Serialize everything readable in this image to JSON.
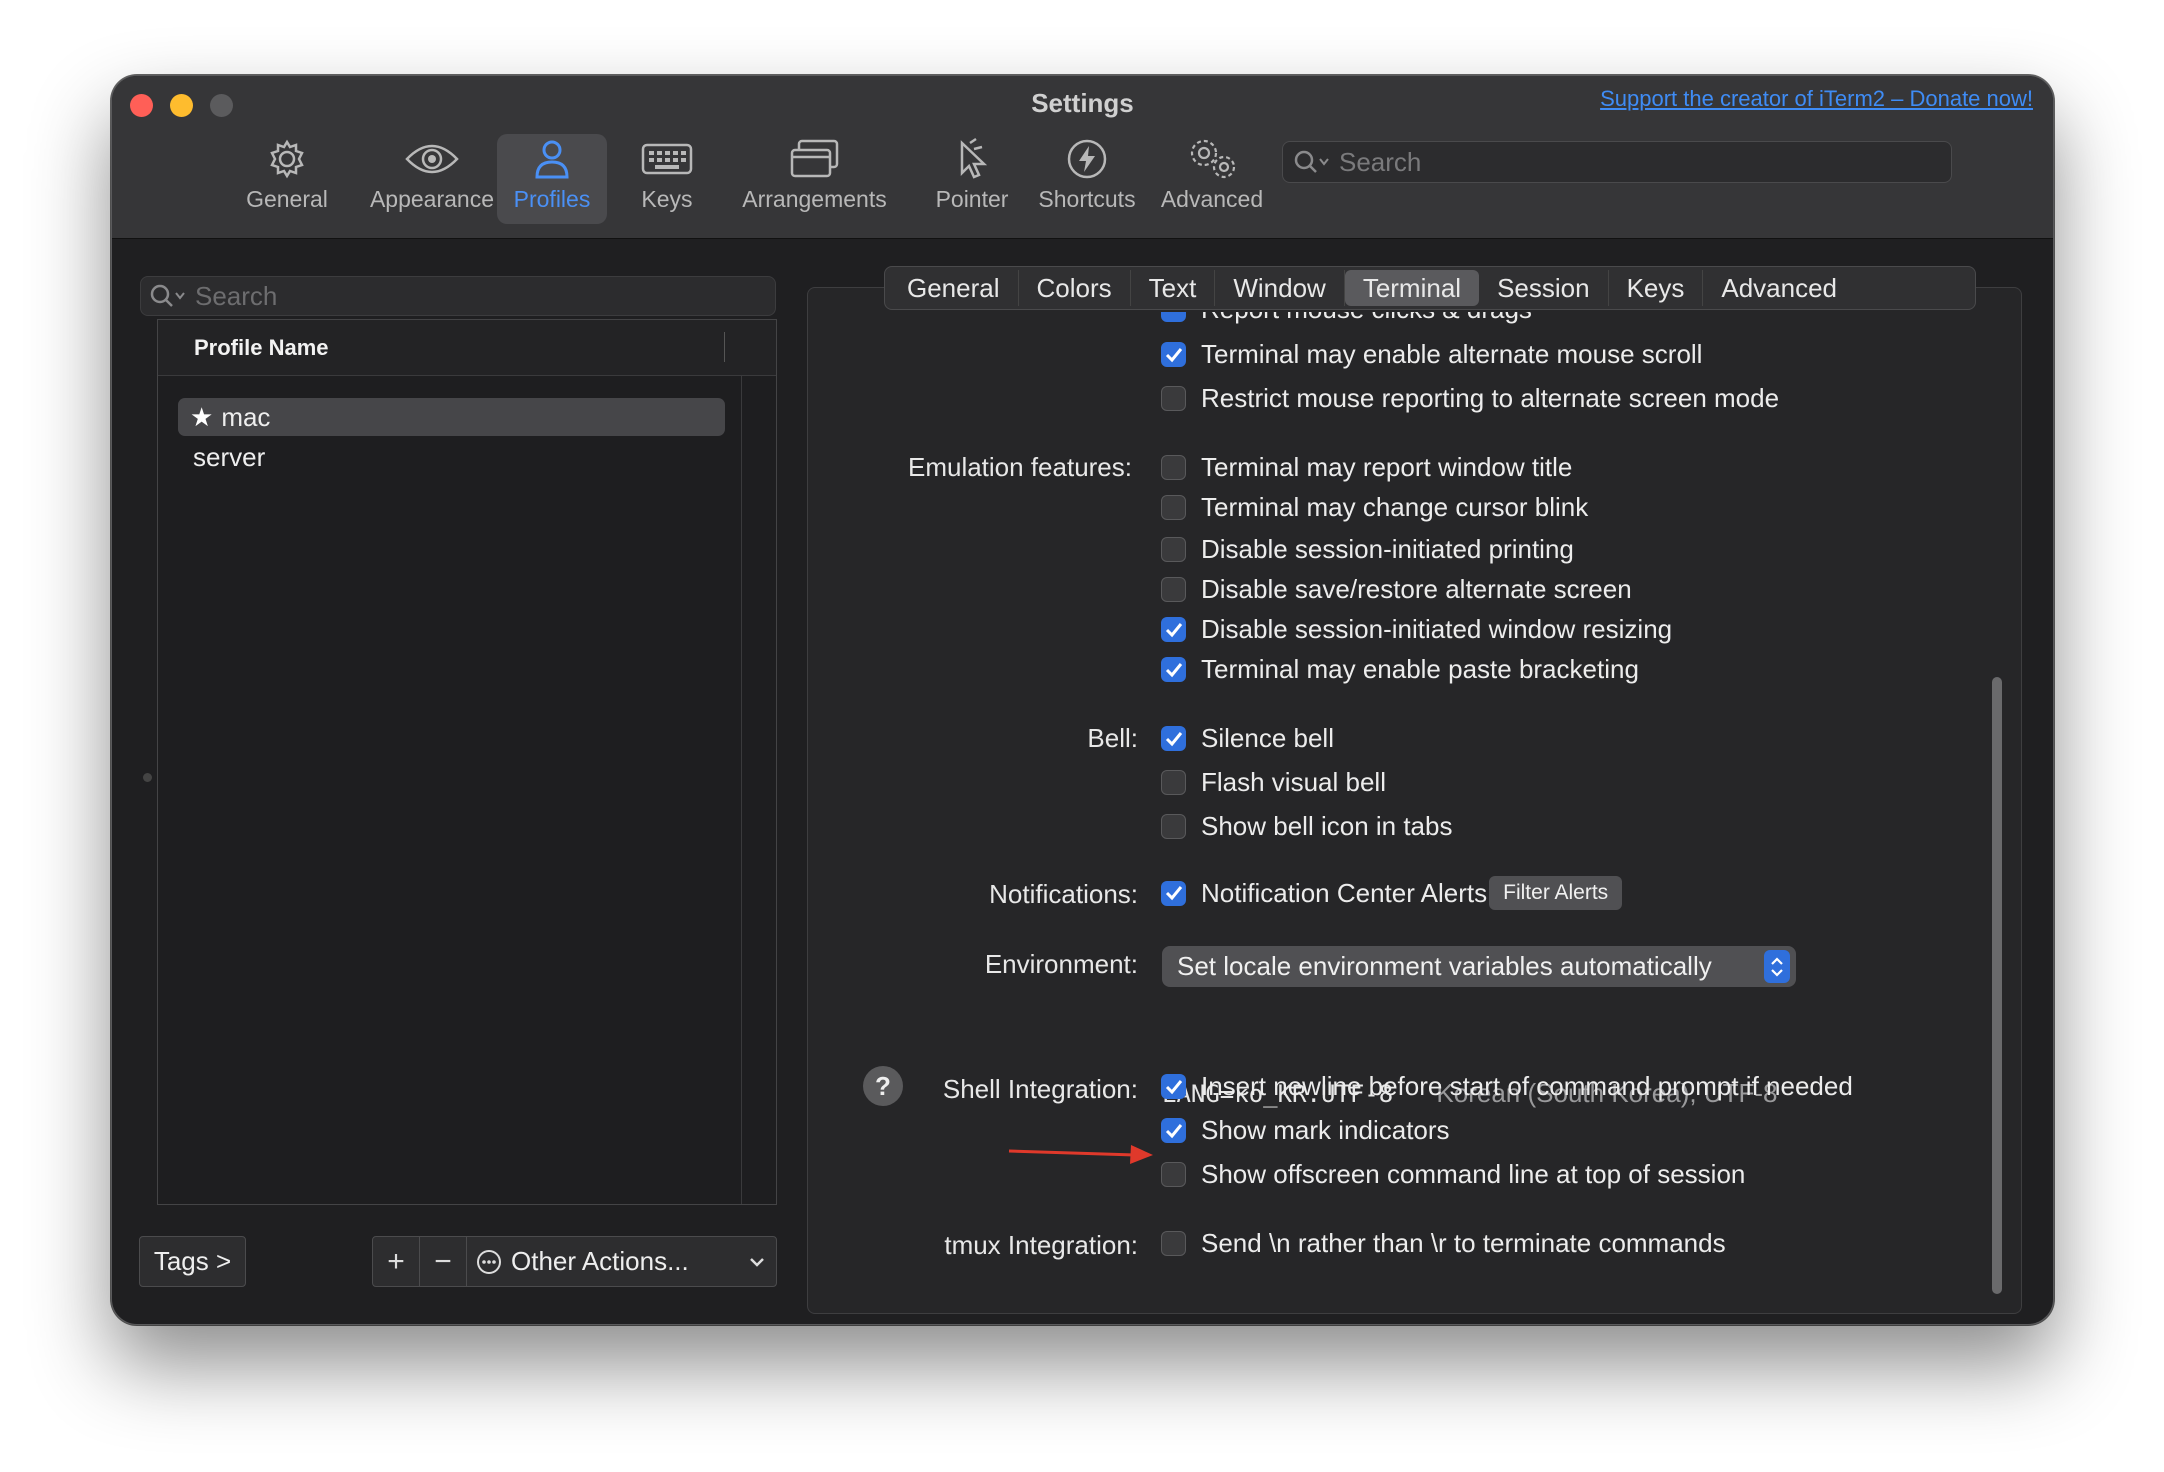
{
  "window": {
    "title": "Settings",
    "donate_link": "Support the creator of iTerm2 – Donate now!"
  },
  "toolbar": {
    "items": [
      {
        "label": "General",
        "icon": "gear-icon"
      },
      {
        "label": "Appearance",
        "icon": "eye-icon"
      },
      {
        "label": "Profiles",
        "icon": "person-icon",
        "active": true
      },
      {
        "label": "Keys",
        "icon": "keyboard-icon"
      },
      {
        "label": "Arrangements",
        "icon": "windows-icon"
      },
      {
        "label": "Pointer",
        "icon": "pointer-icon"
      },
      {
        "label": "Shortcuts",
        "icon": "bolt-icon"
      },
      {
        "label": "Advanced",
        "icon": "gears-icon"
      }
    ],
    "search_placeholder": "Search"
  },
  "profiles": {
    "search_placeholder": "Search",
    "column_header": "Profile Name",
    "items": [
      {
        "name": "mac",
        "default": true,
        "selected": true
      },
      {
        "name": "server",
        "default": false,
        "selected": false
      }
    ],
    "tags_button": "Tags >",
    "add_label": "+",
    "remove_label": "−",
    "other_actions": "Other Actions..."
  },
  "tabs": {
    "items": [
      "General",
      "Colors",
      "Text",
      "Window",
      "Terminal",
      "Session",
      "Keys",
      "Advanced"
    ],
    "active": "Terminal"
  },
  "terminal_settings": {
    "partial_top": "Report mouse clicks & drags",
    "mouse": [
      {
        "label": "Terminal may enable alternate mouse scroll",
        "checked": true
      },
      {
        "label": "Restrict mouse reporting to alternate screen mode",
        "checked": false
      }
    ],
    "emulation_label": "Emulation features:",
    "emulation": [
      {
        "label": "Terminal may report window title",
        "checked": false
      },
      {
        "label": "Terminal may change cursor blink",
        "checked": false
      },
      {
        "label": "Disable session-initiated printing",
        "checked": false
      },
      {
        "label": "Disable save/restore alternate screen",
        "checked": false
      },
      {
        "label": "Disable session-initiated window resizing",
        "checked": true
      },
      {
        "label": "Terminal may enable paste bracketing",
        "checked": true
      }
    ],
    "bell_label": "Bell:",
    "bell": [
      {
        "label": "Silence bell",
        "checked": true
      },
      {
        "label": "Flash visual bell",
        "checked": false
      },
      {
        "label": "Show bell icon in tabs",
        "checked": false
      }
    ],
    "notifications_label": "Notifications:",
    "notifications": {
      "label": "Notification Center Alerts",
      "checked": true,
      "button": "Filter Alerts"
    },
    "environment_label": "Environment:",
    "environment_value": "Set locale environment variables automatically",
    "lang_code": "LANG=ko_KR.UTF-8",
    "lang_desc": "Korean (South Korea), UTF-8",
    "help_label": "?",
    "shell_label": "Shell Integration:",
    "shell": [
      {
        "label": "Insert newline before start of command prompt if needed",
        "checked": true
      },
      {
        "label": "Show mark indicators",
        "checked": true
      },
      {
        "label": "Show offscreen command line at top of session",
        "checked": false
      }
    ],
    "tmux_label": "tmux Integration:",
    "tmux": [
      {
        "label": "Send \\n rather than \\r to terminate commands",
        "checked": false
      }
    ]
  },
  "colors": {
    "accent": "#2f6fdc",
    "annotation_arrow": "#e0392b",
    "link": "#3f8cf5"
  }
}
